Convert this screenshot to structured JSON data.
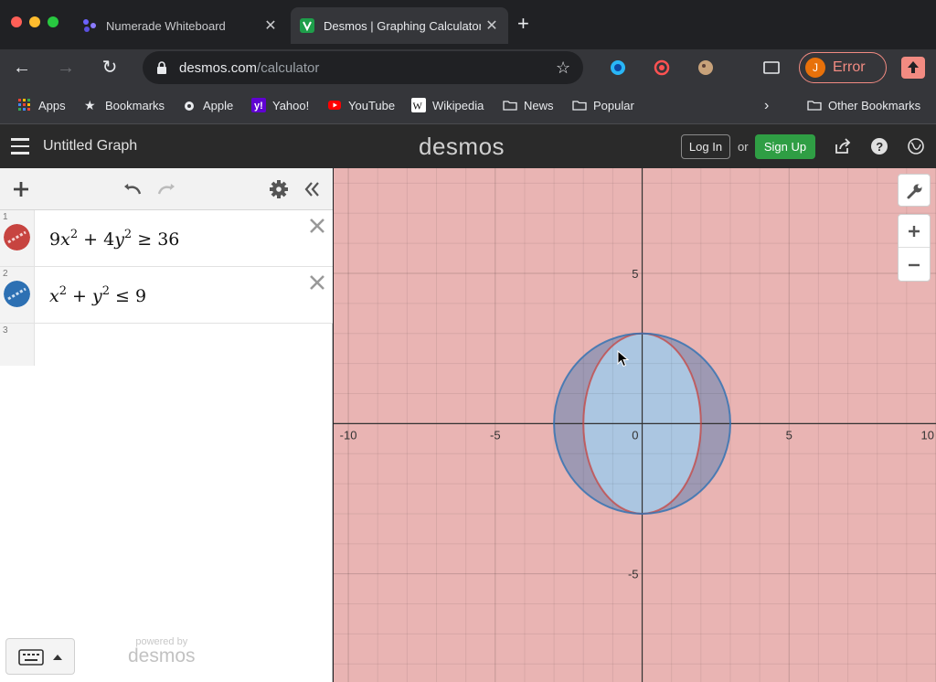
{
  "browser": {
    "tabs": [
      {
        "title": "Numerade Whiteboard",
        "active": false
      },
      {
        "title": "Desmos | Graphing Calculator",
        "active": true
      }
    ],
    "url_domain": "desmos.com",
    "url_path": "/calculator",
    "profile_initial": "J",
    "profile_status": "Error",
    "bookmarks": [
      {
        "label": "Apps",
        "icon": "apps-grid-icon"
      },
      {
        "label": "Bookmarks",
        "icon": "star-icon"
      },
      {
        "label": "Apple",
        "icon": "apple-icon"
      },
      {
        "label": "Yahoo!",
        "icon": "yahoo-icon"
      },
      {
        "label": "YouTube",
        "icon": "youtube-icon"
      },
      {
        "label": "Wikipedia",
        "icon": "wikipedia-icon"
      },
      {
        "label": "News",
        "icon": "folder-icon"
      },
      {
        "label": "Popular",
        "icon": "folder-icon"
      }
    ],
    "other_bookmarks": "Other Bookmarks"
  },
  "desmos": {
    "graph_title": "Untitled Graph",
    "logo": "desmos",
    "login_label": "Log In",
    "or_label": "or",
    "signup_label": "Sign Up",
    "expressions": [
      {
        "index": "1",
        "color": "#c74440",
        "latex": "9x^2 + 4y^2 ≥ 36"
      },
      {
        "index": "2",
        "color": "#2d70b3",
        "latex": "x^2 + y^2 ≤ 9"
      }
    ],
    "empty_index": "3",
    "powered_by": "powered by",
    "powered_logo": "desmos"
  },
  "chart_data": {
    "type": "region",
    "xlim": [
      -10.5,
      10
    ],
    "ylim": [
      -8.6,
      8.5
    ],
    "grid": true,
    "x_tick_labels": [
      "-10",
      "-5",
      "0",
      "5",
      "10"
    ],
    "y_tick_labels": [
      "5",
      "-5"
    ],
    "regions": [
      {
        "expression": "9x^2 + 4y^2 ≥ 36",
        "color": "#c74440",
        "fill": "outside ellipse",
        "ellipse_semi_axes": [
          2,
          3
        ]
      },
      {
        "expression": "x^2 + y^2 ≤ 9",
        "color": "#2d70b3",
        "fill": "inside circle",
        "radius": 3
      }
    ]
  }
}
